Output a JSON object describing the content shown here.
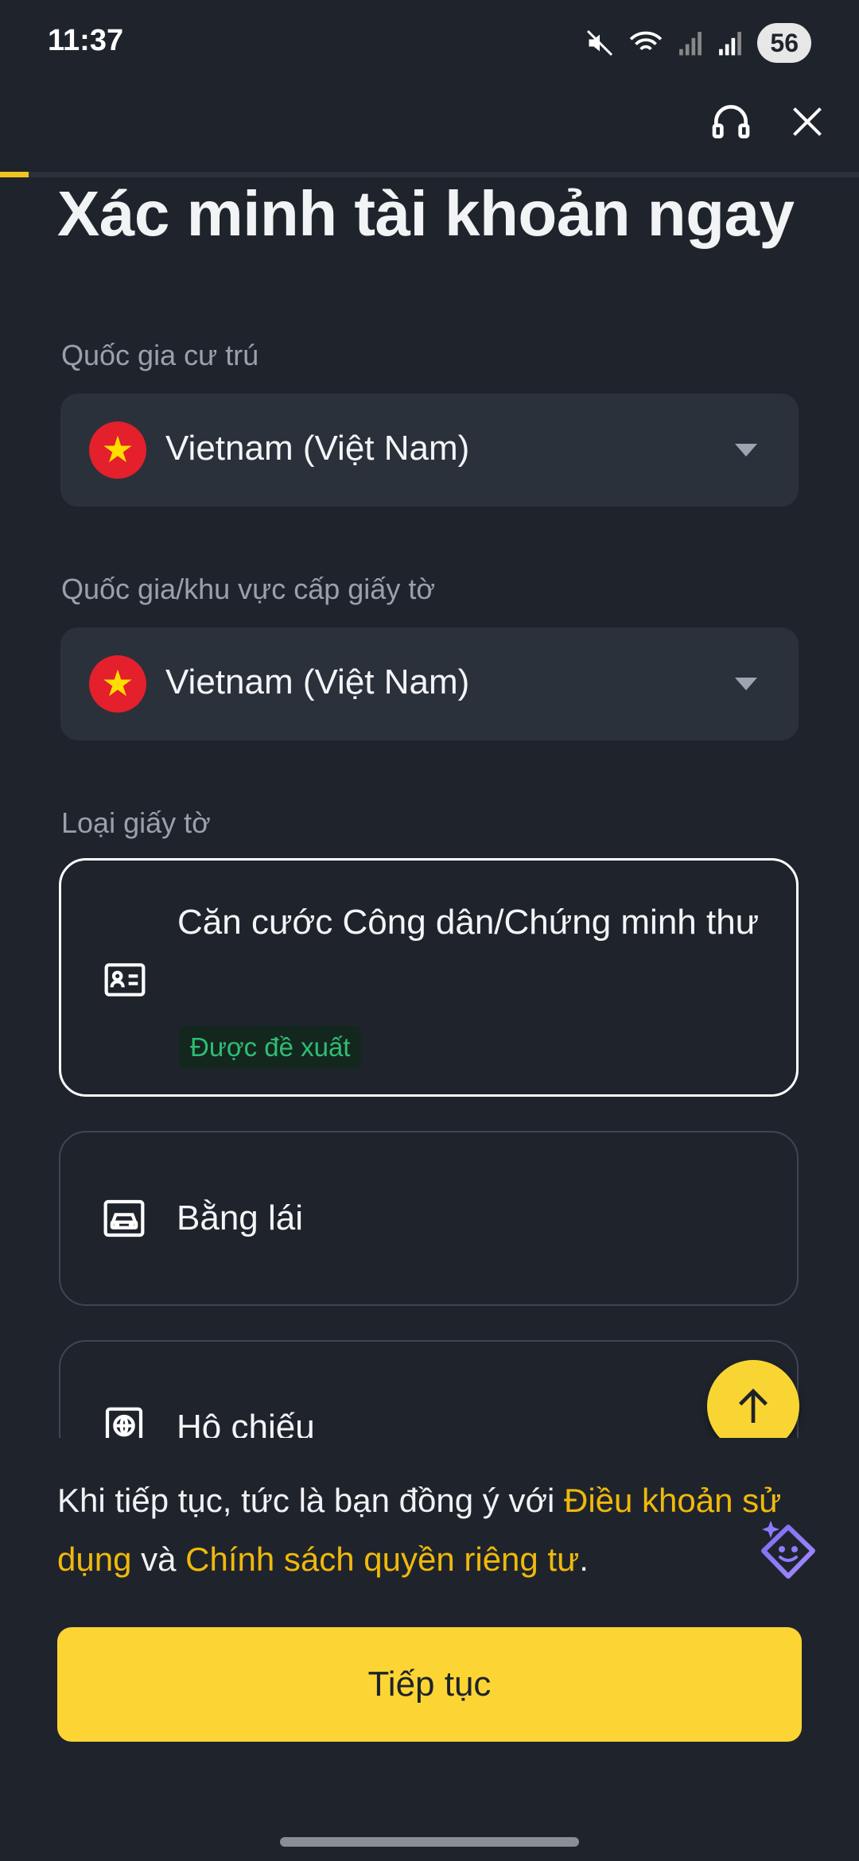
{
  "status_bar": {
    "time": "11:37",
    "battery": "56",
    "icons": [
      "mute-icon",
      "wifi-icon",
      "signal-icon",
      "signal-icon"
    ]
  },
  "topbar": {
    "support_icon": "headset-icon",
    "close_icon": "close-icon"
  },
  "page": {
    "title": "Xác minh tài khoản ngay"
  },
  "residence": {
    "label": "Quốc gia cư trú",
    "value": "Vietnam (Việt Nam)"
  },
  "issuing": {
    "label": "Quốc gia/khu vực cấp giấy tờ",
    "value": "Vietnam (Việt Nam)"
  },
  "documents": {
    "label": "Loại giấy tờ",
    "options": [
      {
        "title": "Căn cước Công dân/Chứng minh thư",
        "badge": "Được đề xuất",
        "icon": "id-card-icon",
        "selected": true
      },
      {
        "title": "Bằng lái",
        "icon": "car-icon",
        "selected": false
      },
      {
        "title": "Hộ chiếu",
        "icon": "passport-icon",
        "selected": false
      }
    ]
  },
  "consent": {
    "prefix": "Khi tiếp tục, tức là bạn đồng ý với ",
    "terms": "Điều khoản sử dụng",
    "middle": " và ",
    "privacy": "Chính sách quyền riêng tư",
    "suffix": "."
  },
  "cta": {
    "label": "Tiếp tục"
  },
  "colors": {
    "background": "#1f242c",
    "accent": "#fcd535",
    "link": "#f0b90b",
    "badge_text": "#2fbd73"
  }
}
